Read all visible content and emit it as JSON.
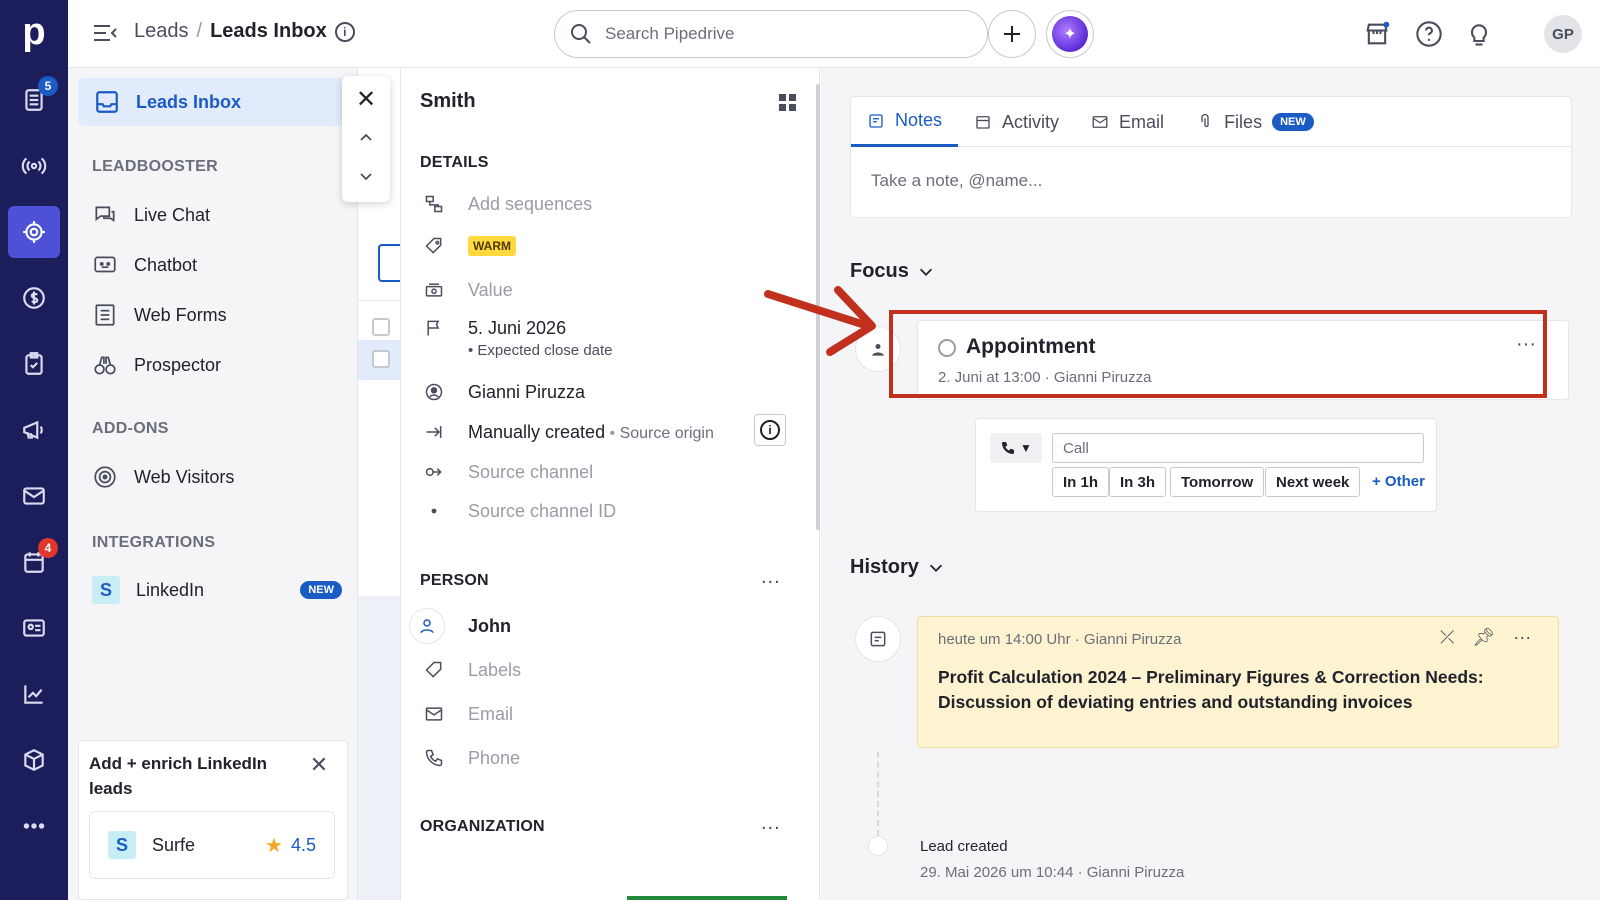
{
  "rail": {
    "badge_leads": "5",
    "badge_calendar": "4",
    "brand_color": "#1b1e5a",
    "active_color": "#4c51d6"
  },
  "topbar": {
    "crumb_parent": "Leads",
    "crumb_sep": "/",
    "crumb_current": "Leads Inbox",
    "search_placeholder": "Search Pipedrive",
    "avatar": "GP"
  },
  "sidebar": {
    "active_label": "Leads Inbox",
    "leadbooster_heading": "LEADBOOSTER",
    "leadbooster_items": [
      "Live Chat",
      "Chatbot",
      "Web Forms",
      "Prospector"
    ],
    "addons_heading": "ADD-ONS",
    "addons_items": [
      "Web Visitors"
    ],
    "integrations_heading": "INTEGRATIONS",
    "integration_item": "LinkedIn",
    "new_badge": "NEW",
    "promo_title": "Add + enrich LinkedIn leads",
    "promo_app": "Surfe",
    "promo_rating": "4.5"
  },
  "detail": {
    "title": "Smith",
    "details_heading": "DETAILS",
    "add_sequences": "Add sequences",
    "label_tag": "WARM",
    "value": "Value",
    "close_date": "5. Juni 2026",
    "close_date_caption": "Expected close date",
    "owner": "Gianni Piruzza",
    "source_origin_value": "Manually created",
    "source_origin_label": "Source origin",
    "source_channel": "Source channel",
    "source_channel_id": "Source channel ID",
    "person_heading": "PERSON",
    "person_name": "John",
    "labels": "Labels",
    "email": "Email",
    "phone": "Phone",
    "organization_heading": "ORGANIZATION",
    "more": "..."
  },
  "right": {
    "tabs": [
      {
        "label": "Notes"
      },
      {
        "label": "Activity"
      },
      {
        "label": "Email"
      },
      {
        "label": "Files"
      }
    ],
    "files_badge": "NEW",
    "note_placeholder": "Take a note, @name...",
    "focus_heading": "Focus",
    "appointment_title": "Appointment",
    "appointment_meta": "2. Juni at 13:00 · Gianni Piruzza",
    "call_placeholder": "Call",
    "quick_buttons": [
      "In 1h",
      "In 3h",
      "Tomorrow",
      "Next week"
    ],
    "quick_other": "+ Other",
    "history_heading": "History",
    "note_meta": "heute um 14:00 Uhr · Gianni Piruzza",
    "note_body": "Profit Calculation 2024 – Preliminary Figures & Correction Needs: Discussion of deviating entries and outstanding invoices",
    "lead_created": "Lead created",
    "lead_created_meta": "29. Mai 2026 um 10:44 · Gianni Piruzza",
    "highlight_color": "#c1301d",
    "note_bg": "#fdf3d0"
  }
}
